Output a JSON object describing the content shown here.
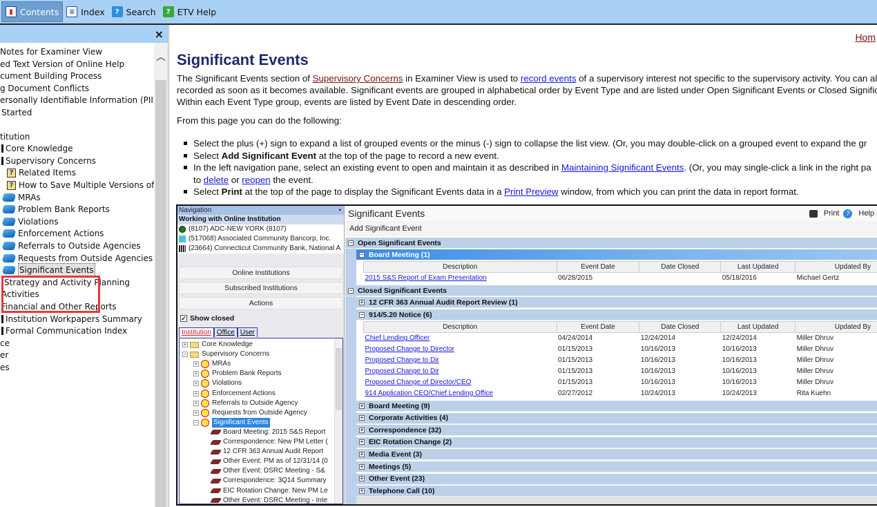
{
  "toolbar": {
    "items": [
      {
        "label": "Contents",
        "icon": "contents-book-icon",
        "active": true
      },
      {
        "label": "Index",
        "icon": "index-icon"
      },
      {
        "label": "Search",
        "icon": "search-help-icon"
      },
      {
        "label": "ETV Help",
        "icon": "etv-help-icon"
      }
    ]
  },
  "toc": {
    "close_label": "×",
    "items": [
      {
        "label": "Notes for Examiner View",
        "prefix": ""
      },
      {
        "label": "ed Text Version of Online Help"
      },
      {
        "label": "cument Building Process"
      },
      {
        "label": "g Document Conflicts"
      },
      {
        "label": "ersonally Identifiable Information (PII)"
      },
      {
        "label": "Started"
      },
      {
        "label": "titution"
      },
      {
        "label": "Core Knowledge"
      },
      {
        "label": "Supervisory Concerns"
      },
      {
        "label": "Related Items"
      },
      {
        "label": "How to Save Multiple Versions of Text"
      },
      {
        "label": "MRAs"
      },
      {
        "label": "Problem Bank Reports"
      },
      {
        "label": "Violations"
      },
      {
        "label": "Enforcement Actions"
      },
      {
        "label": "Referrals to Outside Agencies"
      },
      {
        "label": "Requests from Outside Agencies"
      },
      {
        "label": "Significant Events"
      },
      {
        "label": "Strategy and Activity Planning"
      },
      {
        "label": "Activities"
      },
      {
        "label": "Financial and Other Reports"
      },
      {
        "label": "Institution Workpapers Summary"
      },
      {
        "label": "Formal Communication Index"
      },
      {
        "label": "ce"
      },
      {
        "label": "er"
      },
      {
        "label": "es"
      }
    ]
  },
  "content": {
    "home_link": "Hom",
    "title": "Significant Events",
    "intro": {
      "p1a": "The Significant Events section of ",
      "p1_link1": "Supervisory Concerns",
      "p1b": " in Examiner View is used to ",
      "p1_link2": "record events",
      "p1c": " of a supervisory interest not specific to the supervisory activity. You can als",
      "p2": "recorded as soon as it becomes available. Significant events are grouped in alphabetical order by Event Type and are listed under Open Significant Events or Closed Significa",
      "p3": "Within each Event Type group, events are listed by Event Date in descending order."
    },
    "from_here": "From this page you can do the following:",
    "bullets": {
      "b1": "Select the plus (+) sign to expand a list of grouped events or the minus (-) sign to collapse the list view. (Or, you may double-click on a grouped event to expand the gr",
      "b2a": "Select ",
      "b2b": "Add Significant Event",
      "b2c": " at the top of the page to record a new event.",
      "b3a": "In the left navigation pane, select an existing event to open and maintain it as described in ",
      "b3_link": "Maintaining Significant Events",
      "b3b": ". (Or, you may single-click a link in the right pa",
      "b3c": "to ",
      "b3_link2": "delete",
      "b3d": " or ",
      "b3_link3": "reopen",
      "b3e": " the event.",
      "b4a": "Select ",
      "b4b": "Print",
      "b4c": " at the top of the page to display the Significant Events data in a ",
      "b4_link": "Print Preview",
      "b4d": " window, from which you can print the data in report format."
    }
  },
  "screenshot": {
    "nav": {
      "header": "Navigation",
      "working": "Working with Online Institution",
      "institutions": [
        "(8107) ADC-NEW YORK (8107)",
        "(517068) Associated Community Bancorp, Inc.",
        "(23664) Connecticut Community Bank, National A"
      ],
      "buttons": [
        "Online Institutions",
        "Subscribed Institutions",
        "Actions"
      ],
      "show_closed": "Show closed",
      "tabs": [
        "Institution",
        "Office",
        "User"
      ],
      "tree": [
        "Core Knowledge",
        "Supervisory Concerns",
        "MRAs",
        "Problem Bank Reports",
        "Violations",
        "Enforcement Actions",
        "Referrals to Outside Agency",
        "Requests from Outside Agency",
        "Significant Events",
        "Board Meeting: 2015 S&S Report",
        "Correspondence: New PM Letter (",
        "12 CFR 363 Annual Audit Report",
        "Other Event: PM as of 12/31/14 (0",
        "Other Event: DSRC Meeting - S&",
        "Correspondence: 3Q14 Summary",
        "EIC Rotation Change: New PM Le",
        "Other Event: DSRC Meeting - Inte"
      ]
    },
    "main": {
      "title": "Significant Events",
      "print": "Print",
      "help": "Help",
      "add": "Add Significant Event",
      "open_section": "Open Significant Events",
      "open_group": "Board Meeting (1)",
      "columns": [
        "Description",
        "Event Date",
        "Date Closed",
        "Last Updated",
        "Updated By"
      ],
      "open_rows": [
        [
          "2015 S&S Report of Exam Presentation",
          "06/28/2015",
          "",
          "05/18/2016",
          "Michael Gertz"
        ]
      ],
      "closed_section": "Closed Significant Events",
      "closed_group1": "12 CFR 363 Annual Audit Report Review (1)",
      "closed_group2": "914/5.20 Notice (6)",
      "closed_rows": [
        [
          "Chief Lending Officer",
          "04/24/2014",
          "12/24/2014",
          "12/24/2014",
          "Miller Dhruv"
        ],
        [
          "Proposed Change to Director",
          "01/15/2013",
          "10/16/2013",
          "10/16/2013",
          "Miller Dhruv"
        ],
        [
          "Proposed Change to Dir",
          "01/15/2013",
          "10/16/2013",
          "10/16/2013",
          "Miller Dhruv"
        ],
        [
          "Proposed Change to Dir",
          "01/15/2013",
          "10/16/2013",
          "10/16/2013",
          "Miller Dhruv"
        ],
        [
          "Proposed Change of Director/CEO",
          "01/15/2013",
          "10/16/2013",
          "10/16/2013",
          "Miller Dhruv"
        ],
        [
          "914 Application CEO/Chief Lending Office",
          "02/27/2012",
          "10/24/2013",
          "10/24/2013",
          "Rita Kuehn"
        ]
      ],
      "more_groups": [
        "Board Meeting (9)",
        "Corporate Activities (4)",
        "Correspondence (32)",
        "EIC Rotation Change (2)",
        "Media Event (3)",
        "Meetings (5)",
        "Other Event (23)",
        "Telephone Call (10)"
      ]
    }
  }
}
